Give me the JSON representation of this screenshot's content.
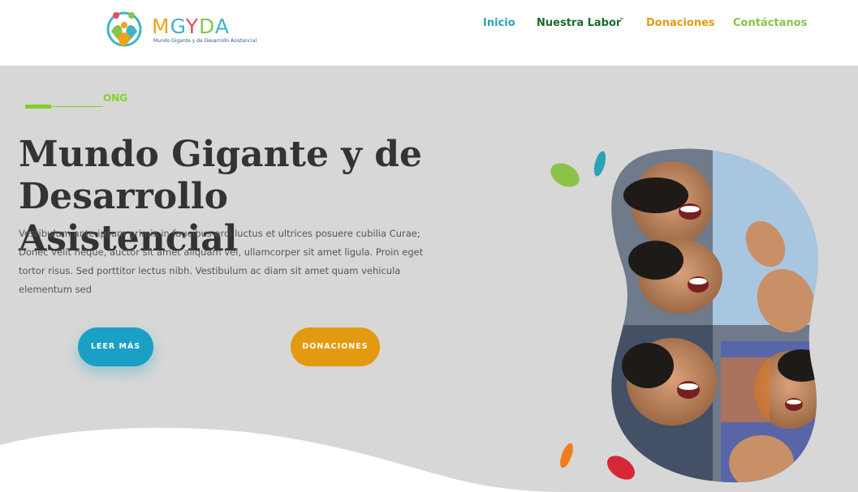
{
  "header": {
    "logo": {
      "text": "MGYDA",
      "letters": [
        "M",
        "G",
        "Y",
        "D",
        "A"
      ],
      "subtitle": "Mundo Gigante y de Desarrollo Asistencial"
    },
    "nav": [
      {
        "label": "Inicio",
        "color": "#2aa2b6"
      },
      {
        "label": "Nuestra Labor",
        "color": "#1a6b2c",
        "has_dropdown": true
      },
      {
        "label": "Donaciones",
        "color": "#e39a10"
      },
      {
        "label": "Contáctanos",
        "color": "#8bc34a"
      }
    ]
  },
  "hero": {
    "tag": "ONG",
    "title": "Mundo Gigante y de Desarrollo Asistencial",
    "description": "Vestibulum ante ipsum primis in faucibus orci luctus et ultrices posuere cubilia Curae; Donec velit neque, auctor sit amet aliquam vel, ullamcorper sit amet ligula. Proin eget tortor risus. Sed porttitor lectus nibh. Vestibulum ac diam sit amet quam vehicula elementum sed",
    "buttons": {
      "read_more": "LEER MÁS",
      "donate": "DONACIONES"
    },
    "image_subject": "group of smiling children reaching toward camera"
  },
  "colors": {
    "background": "#d7d7d7",
    "accent_green": "#7ed321",
    "button_blue": "#1aa0c5",
    "button_orange": "#e39a10",
    "title": "#333333"
  },
  "icons": [
    "chevron-down-icon"
  ]
}
